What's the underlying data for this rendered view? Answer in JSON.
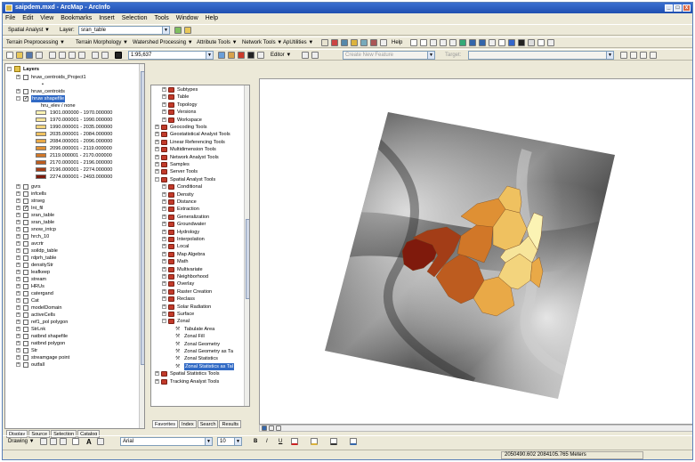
{
  "window": {
    "title": "saipdem.mxd - ArcMap - ArcInfo",
    "min_glyph": "_",
    "max_glyph": "□",
    "close_glyph": "x"
  },
  "menu": [
    "File",
    "Edit",
    "View",
    "Bookmarks",
    "Insert",
    "Selection",
    "Tools",
    "Window",
    "Help"
  ],
  "spatial_analyst": {
    "label": "Spatial Analyst ▼",
    "layer_label": "Layer:",
    "layer_value": "sran_table"
  },
  "toolbar3": {
    "terrain_preprocessing": "Terrain Preprocessing ▼",
    "terrain_morphology": "Terrain Morphology ▼",
    "watershed_processing": "Watershed Processing ▼",
    "attribute_tools": "Attribute Tools ▼",
    "network_tools": "Network Tools ▼",
    "apuntities": "ApUtilities ▼",
    "help": "Help"
  },
  "toolbar4": {
    "scale": "1:95,637",
    "editor": "Editor ▼",
    "task": "Create New Feature",
    "target": "Target:"
  },
  "toc": {
    "tabs": [
      "Display",
      "Source",
      "Selection",
      "Catalog"
    ],
    "layers_title": "Layers",
    "entries": [
      {
        "label": "hruw_centroids_Project1",
        "indent": 1,
        "checked": false,
        "expand": "+"
      },
      {
        "label": "•",
        "indent": 3,
        "checked": null,
        "expand": ""
      },
      {
        "label": "hruw_centroids",
        "indent": 1,
        "checked": false,
        "expand": "+"
      },
      {
        "label": "hruw shapefile",
        "indent": 1,
        "checked": true,
        "expand": "−",
        "selected": true
      }
    ],
    "legend_field": "hru_elev / none",
    "legend": [
      {
        "label": "1901.000000 - 1970.000000",
        "color": "#fbf3b4"
      },
      {
        "label": "1970.000001 - 1990.000000",
        "color": "#f7e59b"
      },
      {
        "label": "1990.000001 - 2035.000000",
        "color": "#f3d47d"
      },
      {
        "label": "2035.000001 - 2084.000000",
        "color": "#efc160"
      },
      {
        "label": "2084.000001 - 2096.000000",
        "color": "#e9a947"
      },
      {
        "label": "2096.000001 - 2119.000000",
        "color": "#df9034"
      },
      {
        "label": "2119.000001 - 2170.000000",
        "color": "#d17728"
      },
      {
        "label": "2170.000001 - 2196.000000",
        "color": "#bd5c1f"
      },
      {
        "label": "2196.000001 - 2274.000000",
        "color": "#a33d17"
      },
      {
        "label": "2274.000001 - 2493.000000",
        "color": "#7f1a0c"
      }
    ],
    "layers": [
      {
        "label": "gvrs",
        "checked": false
      },
      {
        "label": "infcells",
        "checked": false
      },
      {
        "label": "strseg",
        "checked": false
      },
      {
        "label": "Int_fil",
        "checked": true
      },
      {
        "label": "sran_table",
        "checked": false
      },
      {
        "label": "sran_table",
        "checked": false
      },
      {
        "label": "snow_intcp",
        "checked": false
      },
      {
        "label": "hrch_10",
        "checked": false
      },
      {
        "label": "avcrtr",
        "checked": false
      },
      {
        "label": "soildp_table",
        "checked": false
      },
      {
        "label": "rdprh_table",
        "checked": false
      },
      {
        "label": "densityStr",
        "checked": false
      },
      {
        "label": "leafkeep",
        "checked": false
      },
      {
        "label": "stream",
        "checked": false
      },
      {
        "label": "HRUs",
        "checked": false
      },
      {
        "label": "catergand",
        "checked": false
      },
      {
        "label": "Cat",
        "checked": false
      },
      {
        "label": "modelDomain",
        "checked": false
      },
      {
        "label": "activeCells",
        "checked": false
      },
      {
        "label": "ref1_pol polygon",
        "checked": false
      },
      {
        "label": "StrLnk",
        "checked": false
      },
      {
        "label": "natbnd shapefile",
        "checked": false
      },
      {
        "label": "natbnd polygon",
        "checked": false
      },
      {
        "label": "Str",
        "checked": false
      },
      {
        "label": "streamgage point",
        "checked": false
      },
      {
        "label": "outfall",
        "checked": false
      }
    ]
  },
  "arctoolbox": {
    "tabs": [
      "Favorites",
      "Index",
      "Search",
      "Results"
    ],
    "items": [
      {
        "label": "Subtypes",
        "level": 1,
        "exp": "+",
        "icon": "toolbox"
      },
      {
        "label": "Table",
        "level": 1,
        "exp": "+",
        "icon": "toolbox"
      },
      {
        "label": "Topology",
        "level": 1,
        "exp": "+",
        "icon": "toolbox"
      },
      {
        "label": "Versions",
        "level": 1,
        "exp": "+",
        "icon": "toolbox"
      },
      {
        "label": "Workspace",
        "level": 1,
        "exp": "+",
        "icon": "toolbox"
      },
      {
        "label": "Geocoding Tools",
        "level": 0,
        "exp": "+",
        "icon": "toolbox"
      },
      {
        "label": "Geostatistical Analyst Tools",
        "level": 0,
        "exp": "+",
        "icon": "toolbox"
      },
      {
        "label": "Linear Referencing Tools",
        "level": 0,
        "exp": "+",
        "icon": "toolbox"
      },
      {
        "label": "Multidimension Tools",
        "level": 0,
        "exp": "+",
        "icon": "toolbox"
      },
      {
        "label": "Network Analyst Tools",
        "level": 0,
        "exp": "+",
        "icon": "toolbox"
      },
      {
        "label": "Samples",
        "level": 0,
        "exp": "+",
        "icon": "toolbox"
      },
      {
        "label": "Server Tools",
        "level": 0,
        "exp": "+",
        "icon": "toolbox"
      },
      {
        "label": "Spatial Analyst Tools",
        "level": 0,
        "exp": "−",
        "icon": "toolbox"
      },
      {
        "label": "Conditional",
        "level": 1,
        "exp": "+",
        "icon": "toolbox"
      },
      {
        "label": "Density",
        "level": 1,
        "exp": "+",
        "icon": "toolbox"
      },
      {
        "label": "Distance",
        "level": 1,
        "exp": "+",
        "icon": "toolbox"
      },
      {
        "label": "Extraction",
        "level": 1,
        "exp": "+",
        "icon": "toolbox"
      },
      {
        "label": "Generalization",
        "level": 1,
        "exp": "+",
        "icon": "toolbox"
      },
      {
        "label": "Groundwater",
        "level": 1,
        "exp": "+",
        "icon": "toolbox"
      },
      {
        "label": "Hydrology",
        "level": 1,
        "exp": "+",
        "icon": "toolbox"
      },
      {
        "label": "Interpolation",
        "level": 1,
        "exp": "+",
        "icon": "toolbox"
      },
      {
        "label": "Local",
        "level": 1,
        "exp": "+",
        "icon": "toolbox"
      },
      {
        "label": "Map Algebra",
        "level": 1,
        "exp": "+",
        "icon": "toolbox"
      },
      {
        "label": "Math",
        "level": 1,
        "exp": "+",
        "icon": "toolbox"
      },
      {
        "label": "Multivariate",
        "level": 1,
        "exp": "+",
        "icon": "toolbox"
      },
      {
        "label": "Neighborhood",
        "level": 1,
        "exp": "+",
        "icon": "toolbox"
      },
      {
        "label": "Overlay",
        "level": 1,
        "exp": "+",
        "icon": "toolbox"
      },
      {
        "label": "Raster Creation",
        "level": 1,
        "exp": "+",
        "icon": "toolbox"
      },
      {
        "label": "Reclass",
        "level": 1,
        "exp": "+",
        "icon": "toolbox"
      },
      {
        "label": "Solar Radiation",
        "level": 1,
        "exp": "+",
        "icon": "toolbox"
      },
      {
        "label": "Surface",
        "level": 1,
        "exp": "+",
        "icon": "toolbox"
      },
      {
        "label": "Zonal",
        "level": 1,
        "exp": "−",
        "icon": "toolbox"
      },
      {
        "label": "Tabulate Area",
        "level": 2,
        "exp": "",
        "icon": "tool"
      },
      {
        "label": "Zonal Fill",
        "level": 2,
        "exp": "",
        "icon": "tool"
      },
      {
        "label": "Zonal Geometry",
        "level": 2,
        "exp": "",
        "icon": "tool"
      },
      {
        "label": "Zonal Geometry as Ta",
        "level": 2,
        "exp": "",
        "icon": "tool"
      },
      {
        "label": "Zonal Statistics",
        "level": 2,
        "exp": "",
        "icon": "tool"
      },
      {
        "label": "Zonal Statistics as Tal",
        "level": 2,
        "exp": "",
        "icon": "tool",
        "selected": true
      },
      {
        "label": "Spatial Statistics Tools",
        "level": 0,
        "exp": "+",
        "icon": "toolbox"
      },
      {
        "label": "Tracking Analyst Tools",
        "level": 0,
        "exp": "+",
        "icon": "toolbox"
      }
    ]
  },
  "drawing": {
    "label": "Drawing ▼",
    "font": "Arial",
    "size": "10",
    "bold": "B",
    "italic": "I",
    "underline": "U",
    "text_tool": "A"
  },
  "status": {
    "coords": "2050490.602  2084105.765 Meters"
  },
  "colors": {
    "accent": "#1f4fb0",
    "selection": "#316ac5",
    "watershed_low": "#fbf3b4",
    "watershed_high": "#7f1a0c"
  }
}
